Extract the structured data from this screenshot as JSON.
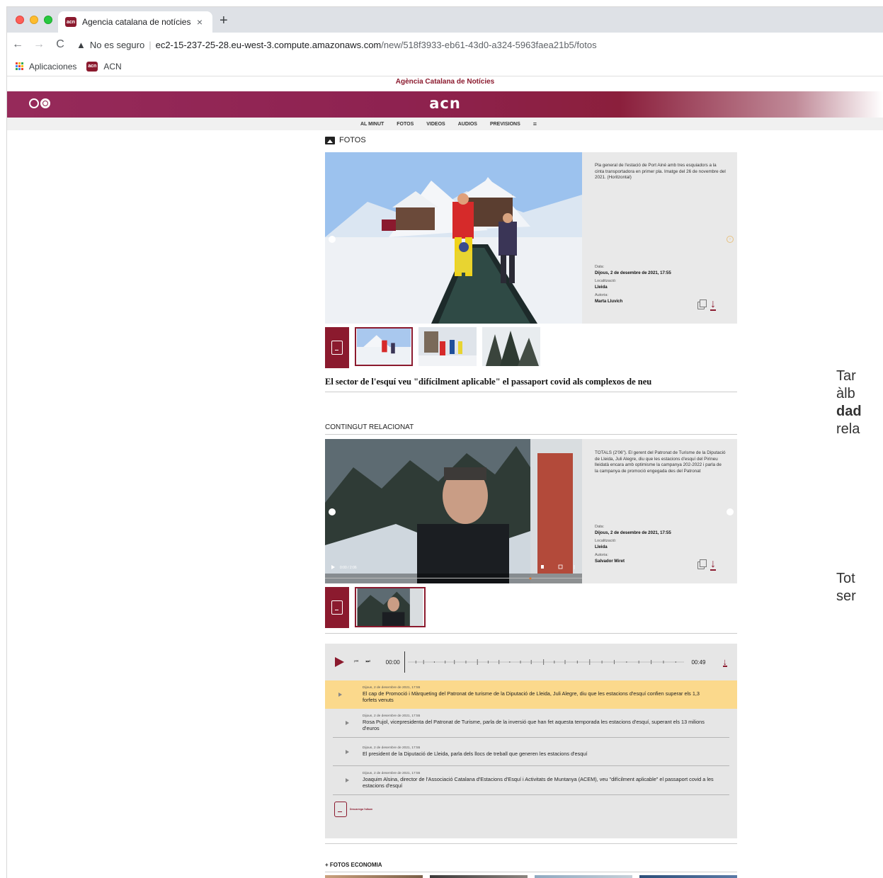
{
  "browser": {
    "tab_title": "Agencia catalana de notícies",
    "favicon_text": "acn",
    "close_glyph": "×",
    "new_tab_glyph": "+",
    "back_glyph": "←",
    "forward_glyph": "→",
    "reload_glyph": "C",
    "warning_glyph": "▲",
    "security_text": "No es seguro",
    "url_host": "ec2-15-237-25-28.eu-west-3.compute.amazonaws.com",
    "url_path": "/new/518f3933-eb61-43d0-a324-5963faea21b5/fotos",
    "bookmarks": [
      {
        "label": "Aplicaciones",
        "icon": "apps-grid-icon"
      },
      {
        "label": "ACN",
        "icon": "acn-favicon"
      }
    ]
  },
  "site": {
    "top_label": "Agència Catalana de Notícies",
    "logo": "acn",
    "nav": [
      "AL MINUT",
      "FOTOS",
      "VIDEOS",
      "AUDIOS",
      "PREVISIONS",
      "≡"
    ],
    "brand_color": "#8b1a2e"
  },
  "photos": {
    "section_title": "FOTOS",
    "caption": "Pla general de l'estació de Port Ainé amb tres esquiadors a la cinta transportadora en primer pla. Imatge del 26 de novembre del 2021. (Horitzontal)",
    "date_label": "Data:",
    "date": "Dijous, 2 de desembre de 2021, 17:55",
    "location_label": "Localització:",
    "location": "Lleida",
    "author_label": "Autoria:",
    "author": "Marta Lluvich",
    "headline": "El sector de l'esquí veu \"difícilment aplicable\" el passaport covid als complexos de neu",
    "thumbnail_count": 3
  },
  "related": {
    "section_title": "CONTINGUT RELACIONAT",
    "caption": "TOTALS (2'06\"). El gerent del Patronat de Turisme de la Diputació de Lleida, Juli Alegre, diu que les estacions d'esquí del Pirineu lleidatà encara amb optimisme la campanya 202-2022 i parla de la campanya de promoció engegada des del Patronat",
    "date_label": "Data:",
    "date": "Dijous, 2 de desembre de 2021, 17:55",
    "location_label": "Localització:",
    "location": "Lleida",
    "author_label": "Autoria:",
    "author": "Salvador Miret",
    "video_time": "0:00 / 2:06"
  },
  "audio": {
    "current_time": "00:00",
    "total_time": "00:49",
    "tracks": [
      {
        "date": "Dijous, 2 de desembre de 2021, 17:55",
        "title": "El cap de Promoció i Màrqueting del Patronat de turisme de la Diputació de Lleida, Juli Alegre, diu que les estacions d'esquí confien superar els 1,3 forfets venuts",
        "active": true
      },
      {
        "date": "Dijous, 2 de desembre de 2021, 17:55",
        "title": "Rosa Pujol, vicepresidenta del Patronat de Turisme, parla de la inversió que han fet aquesta temporada les estacions d'esquí, superant els 13 milions d'euros",
        "active": false
      },
      {
        "date": "Dijous, 2 de desembre de 2021, 17:55",
        "title": "El president de la Diputació de Lleida, parla dels llocs de treball que generen les estacions d'esquí",
        "active": false
      },
      {
        "date": "Dijous, 2 de desembre de 2021, 17:55",
        "title": "Joaquim Alsina, director de l'Associació Catalana d'Estacions d'Esquí i Activitats de Muntanya (ACEM), veu \"difícilment aplicable\" el passaport covid a les estacions d'esquí",
        "active": false
      }
    ],
    "album_label": "Descarrega l'album"
  },
  "more": {
    "title": "+ FOTOS ECONOMIA"
  },
  "side_text": {
    "line1": "Tar",
    "line2": "àlb",
    "line3": "dad",
    "line4": "rela",
    "line5": "Tot",
    "line6": "ser"
  }
}
